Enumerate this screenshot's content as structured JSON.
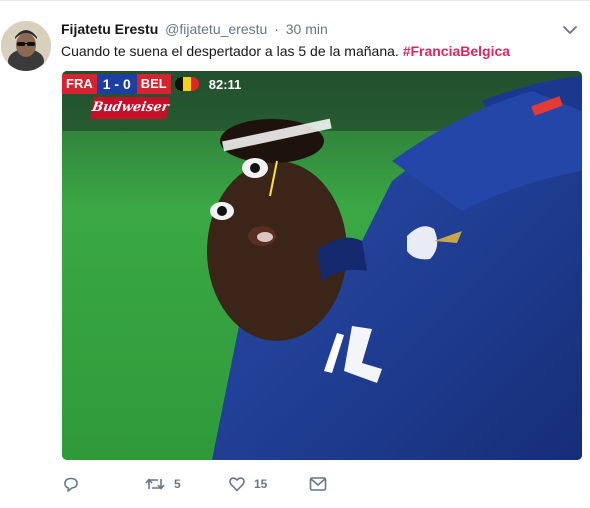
{
  "tweet": {
    "display_name": "Fijatetu Erestu",
    "handle": "@fijatetu_erestu",
    "separator": "·",
    "time": "30 min",
    "text": "Cuando te suena el despertador a las 5 de la mañana.",
    "hashtag": "#FranciaBelgica"
  },
  "media": {
    "scoreboard": {
      "home": "FRA",
      "score": "1 - 0",
      "away": "BEL",
      "clock": "82:11"
    },
    "sponsor": "Budweiser",
    "jersey_number": "14"
  },
  "actions": {
    "reply_count": "",
    "retweet_count": "5",
    "like_count": "15"
  },
  "colors": {
    "hashtag": "#e0245e",
    "muted": "#657786",
    "jersey": "#1e3a8f",
    "pitch": "#2e9a3b"
  },
  "icons": [
    "chevron-down-icon",
    "reply-icon",
    "retweet-icon",
    "heart-icon",
    "envelope-icon"
  ]
}
